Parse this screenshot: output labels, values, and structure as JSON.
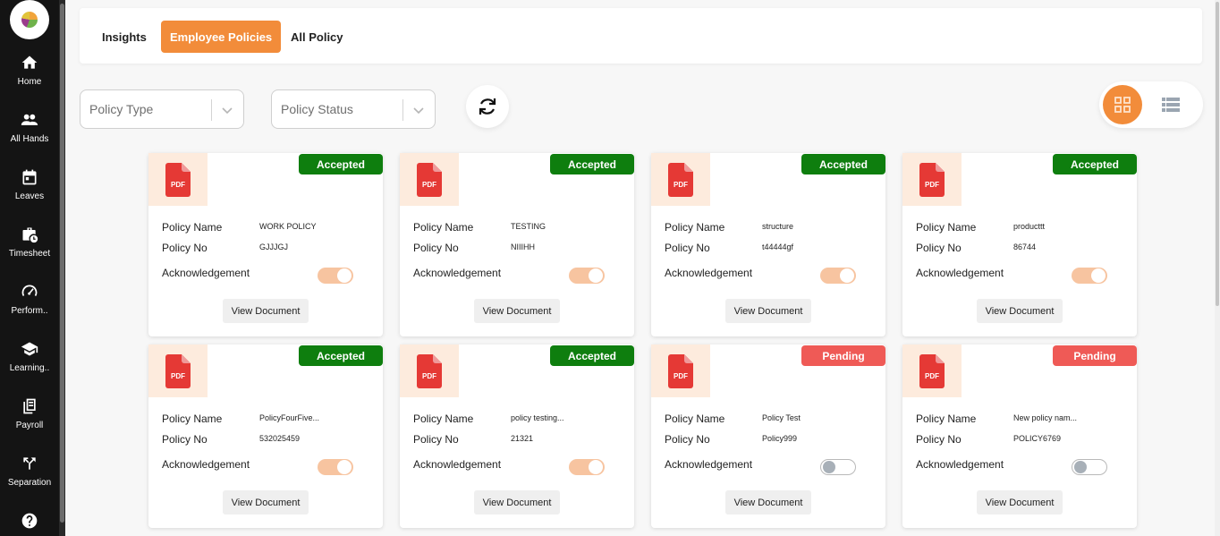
{
  "sidebar": {
    "items": [
      {
        "label": "Home",
        "icon": "home-icon"
      },
      {
        "label": "All Hands",
        "icon": "people-icon"
      },
      {
        "label": "Leaves",
        "icon": "calendar-icon"
      },
      {
        "label": "Timesheet",
        "icon": "briefcase-clock-icon"
      },
      {
        "label": "Perform..",
        "icon": "speedometer-icon"
      },
      {
        "label": "Learning..",
        "icon": "graduation-cap-icon"
      },
      {
        "label": "Payroll",
        "icon": "payroll-icon"
      },
      {
        "label": "Separation",
        "icon": "split-arrow-icon"
      },
      {
        "label": "",
        "icon": "help-icon"
      }
    ]
  },
  "tabs": [
    {
      "label": "Insights",
      "active": false
    },
    {
      "label": "Employee Policies",
      "active": true
    },
    {
      "label": "All Policy",
      "active": false
    }
  ],
  "filters": {
    "policy_type_placeholder": "Policy Type",
    "policy_status_placeholder": "Policy Status"
  },
  "colors": {
    "accent": "#f28c3a",
    "accepted": "#0e7e0e",
    "pending": "#ef5a56",
    "sidebar": "#141414"
  },
  "labels": {
    "policy_name": "Policy Name",
    "policy_no": "Policy No",
    "acknowledgement": "Acknowledgement",
    "view_document": "View Document",
    "pdf": "PDF"
  },
  "policies": [
    {
      "status": "Accepted",
      "name": "WORK POLICY",
      "no": "GJJJGJ",
      "acknowledged": true
    },
    {
      "status": "Accepted",
      "name": "TESTING",
      "no": "NIIIHH",
      "acknowledged": true
    },
    {
      "status": "Accepted",
      "name": "structure",
      "no": "t44444gf",
      "acknowledged": true
    },
    {
      "status": "Accepted",
      "name": "producttt",
      "no": "86744",
      "acknowledged": true
    },
    {
      "status": "Accepted",
      "name": "PolicyFourFive...",
      "no": "532025459",
      "acknowledged": true
    },
    {
      "status": "Accepted",
      "name": "policy testing...",
      "no": "21321",
      "acknowledged": true
    },
    {
      "status": "Pending",
      "name": "Policy Test",
      "no": "Policy999",
      "acknowledged": false
    },
    {
      "status": "Pending",
      "name": "New policy nam...",
      "no": "POLICY6769",
      "acknowledged": false
    }
  ]
}
